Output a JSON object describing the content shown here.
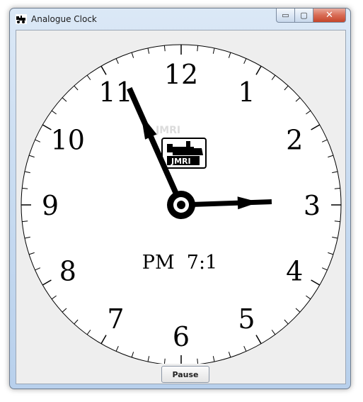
{
  "window": {
    "title": "Analogue Clock",
    "controls": {
      "minimize": "▭",
      "maximize": "▢",
      "close": "✕"
    }
  },
  "clock": {
    "numerals": [
      "12",
      "1",
      "2",
      "3",
      "4",
      "5",
      "6",
      "7",
      "8",
      "9",
      "10",
      "11"
    ],
    "time_display": "PM  7:1",
    "hour_hand_points_to": 3,
    "minute_hand_points_to_minute": 56,
    "logo_text": "JMRI",
    "watermark_text": "JMRI"
  },
  "controls": {
    "pause_label": "Pause"
  },
  "colors": {
    "face": "#ffffff",
    "hands": "#000000",
    "client_bg": "#eeeeee"
  }
}
